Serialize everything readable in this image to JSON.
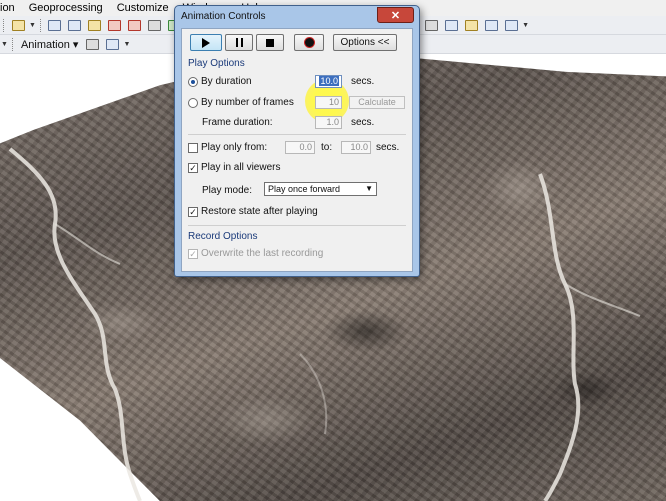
{
  "menubar": {
    "items": [
      "ion",
      "Geoprocessing",
      "Customize",
      "Windows",
      "Help"
    ]
  },
  "toolbar2": {
    "animation_menu": "Animation"
  },
  "dialog": {
    "title": "Animation Controls",
    "close_glyph": "✕",
    "options_button": "Options <<",
    "play_options_header": "Play Options",
    "by_duration_label": "By duration",
    "by_duration_value": "10.0",
    "by_duration_unit": "secs.",
    "by_frames_label": "By number of frames",
    "frames_value": "10",
    "calculate_button": "Calculate",
    "frame_duration_label": "Frame duration:",
    "frame_duration_value": "1.0",
    "frame_duration_unit": "secs.",
    "play_only_from_label": "Play only from:",
    "play_from_value": "0.0",
    "to_label": "to:",
    "play_to_value": "10.0",
    "play_range_unit": "secs.",
    "play_in_all_viewers_label": "Play in all viewers",
    "play_mode_label": "Play mode:",
    "play_mode_value": "Play once forward",
    "restore_state_label": "Restore state after playing",
    "record_options_header": "Record Options",
    "overwrite_label": "Overwrite the last recording",
    "states": {
      "by_duration": true,
      "by_frames": false,
      "play_only_from": false,
      "play_in_all_viewers": true,
      "restore_state": true,
      "overwrite": true
    }
  },
  "colors": {
    "dialog_frame": "#a9c6e8",
    "close_button": "#c7473a",
    "highlight": "#fff946",
    "section_header": "#1a3a7a"
  }
}
